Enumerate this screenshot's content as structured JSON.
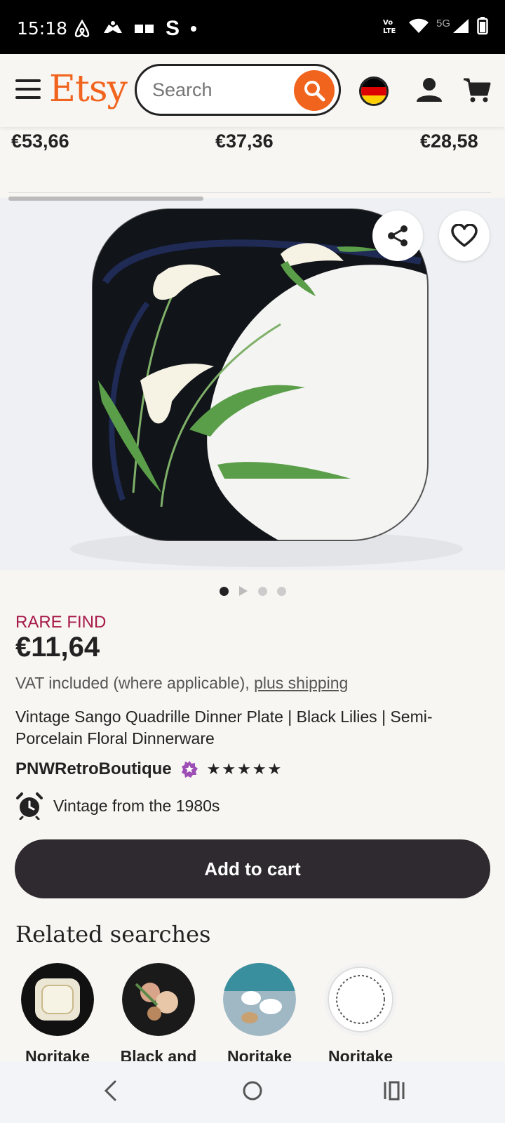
{
  "status_bar": {
    "time": "15:18",
    "left_icons": [
      "airbnb-icon",
      "hoodie-icon",
      "badge-icon",
      "s-icon",
      "dot-icon"
    ],
    "right_icons": [
      "volte-icon",
      "wifi-icon",
      "signal-5g-icon",
      "battery-icon"
    ],
    "network_label": "5G"
  },
  "header": {
    "logo": "Etsy",
    "search_placeholder": "Search"
  },
  "previous_prices": [
    "€53,66",
    "€37,36",
    "€28,58"
  ],
  "image": {
    "carousel_count": 4,
    "carousel_active": 0
  },
  "listing": {
    "badge": "RARE FIND",
    "price": "€11,64",
    "vat_text": "VAT included (where applicable), ",
    "shipping_link": "plus shipping",
    "title": "Vintage Sango Quadrille Dinner Plate | Black Lilies | Semi-Porcelain Floral Dinnerware",
    "shop_name": "PNWRetroBoutique",
    "rating_stars": 5,
    "vintage_text": "Vintage from the 1980s",
    "add_to_cart": "Add to cart"
  },
  "related": {
    "title": "Related searches",
    "items": [
      {
        "label": "Noritake"
      },
      {
        "label": "Black and"
      },
      {
        "label": "Noritake"
      },
      {
        "label": "Noritake"
      }
    ]
  },
  "colors": {
    "accent": "#f1641e",
    "rare": "#a61a4a",
    "button_dark": "#2f2a2f",
    "star_seller": "#9d4fb5"
  }
}
